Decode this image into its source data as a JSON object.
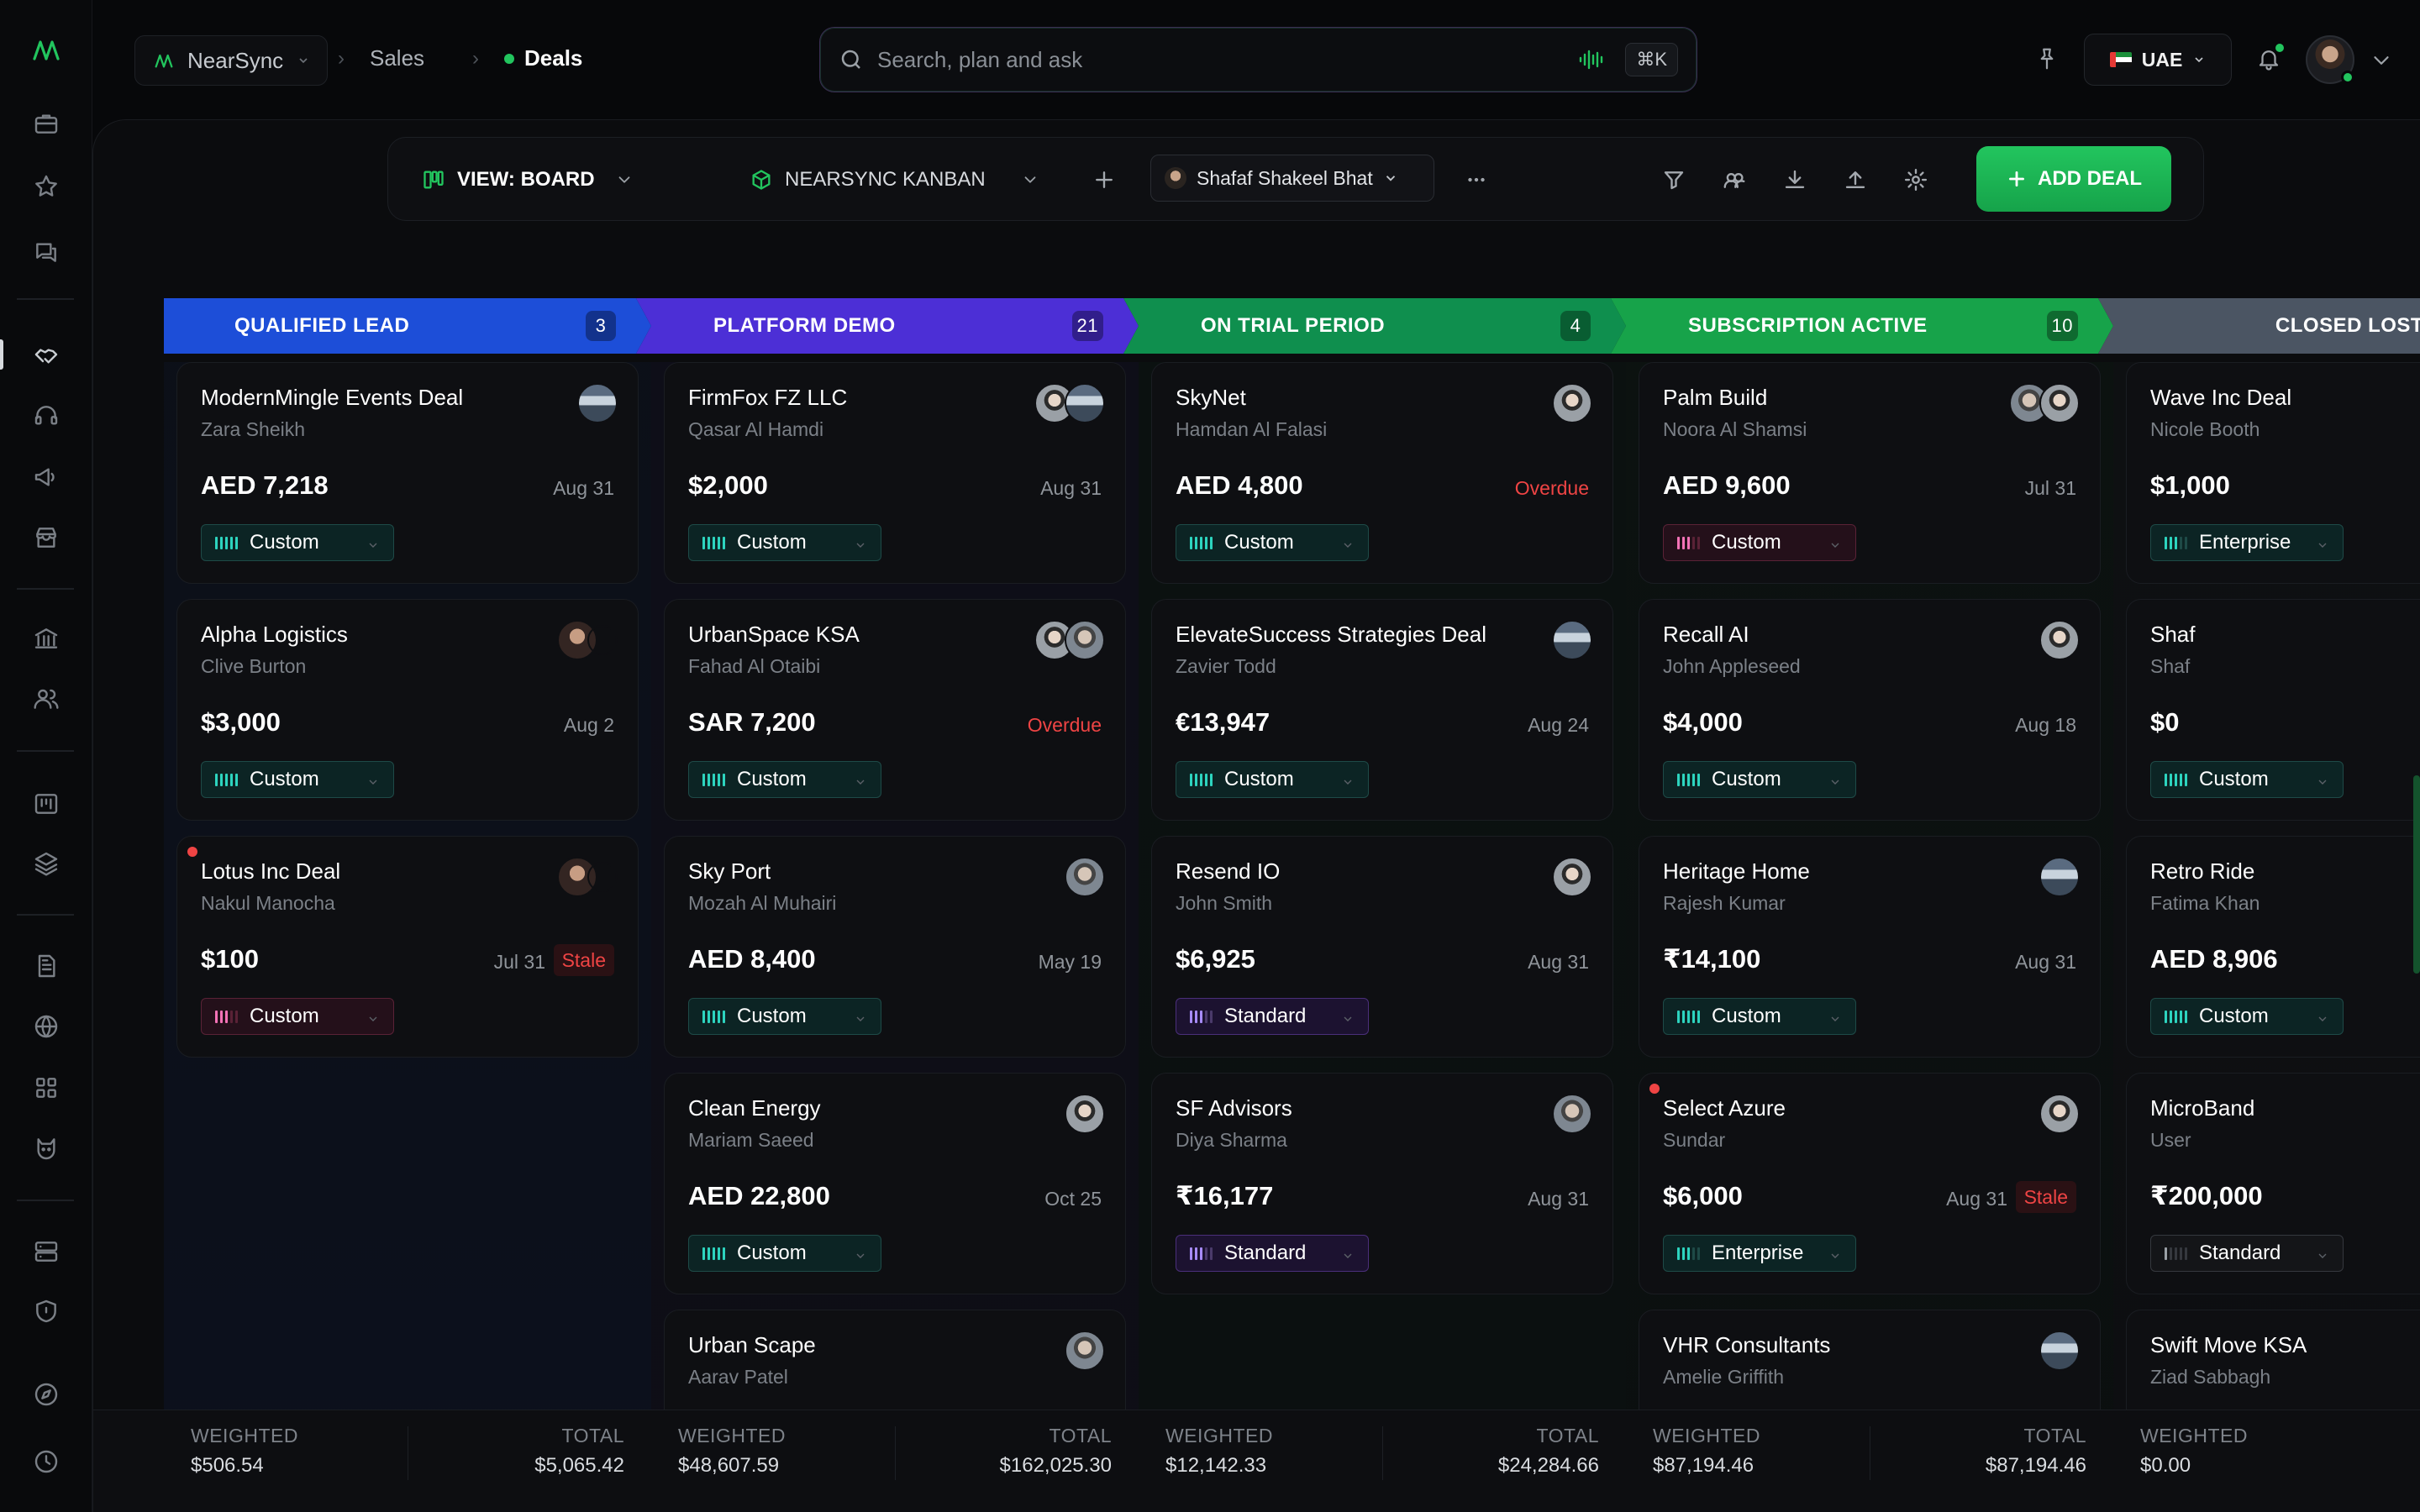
{
  "brand": {
    "name": "NearSync"
  },
  "breadcrumb": {
    "workspace": "NearSync",
    "section": "Sales",
    "current": "Deals"
  },
  "search": {
    "placeholder": "Search, plan and ask",
    "shortcut": "⌘K"
  },
  "region": {
    "label": "UAE"
  },
  "toolbar": {
    "view_label": "VIEW: BOARD",
    "pipeline_label": "NEARSYNC KANBAN",
    "owner_name": "Shafaf Shakeel Bhat",
    "add_deal_label": "ADD DEAL"
  },
  "colors": {
    "accent": "#22c55e",
    "qualified_lead": "#1d4ed8",
    "platform_demo": "#4c2fd6",
    "on_trial": "#0f8f4e",
    "subscription_active": "#17a34a",
    "closed_lost": "#4b5563",
    "overdue": "#ef4444"
  },
  "stages": [
    {
      "name": "QUALIFIED LEAD",
      "count": "3"
    },
    {
      "name": "PLATFORM DEMO",
      "count": "21"
    },
    {
      "name": "ON TRIAL PERIOD",
      "count": "4"
    },
    {
      "name": "SUBSCRIPTION ACTIVE",
      "count": "10"
    },
    {
      "name": "CLOSED LOST",
      "count": ""
    }
  ],
  "columns": [
    {
      "cards": [
        {
          "title": "ModernMingle Events Deal",
          "contact": "Zara Sheikh",
          "amount": "AED 7,218",
          "date": "Aug 31",
          "plan": "Custom"
        },
        {
          "title": "Alpha Logistics",
          "contact": "Clive Burton",
          "amount": "$3,000",
          "date": "Aug 2",
          "plan": "Custom"
        },
        {
          "title": "Lotus Inc Deal",
          "contact": "Nakul Manocha",
          "amount": "$100",
          "date": "Jul 31",
          "stale": "Stale",
          "plan": "Custom"
        }
      ]
    },
    {
      "cards": [
        {
          "title": "FirmFox FZ LLC",
          "contact": "Qasar Al Hamdi",
          "amount": "$2,000",
          "date": "Aug 31",
          "plan": "Custom"
        },
        {
          "title": "UrbanSpace KSA",
          "contact": "Fahad Al Otaibi",
          "amount": "SAR 7,200",
          "date": "Overdue",
          "plan": "Custom"
        },
        {
          "title": "Sky Port",
          "contact": "Mozah Al Muhairi",
          "amount": "AED 8,400",
          "date": "May 19",
          "plan": "Custom"
        },
        {
          "title": "Clean Energy",
          "contact": "Mariam Saeed",
          "amount": "AED 22,800",
          "date": "Oct 25",
          "plan": "Custom"
        },
        {
          "title": "Urban Scape",
          "contact": "Aarav Patel"
        }
      ]
    },
    {
      "cards": [
        {
          "title": "SkyNet",
          "contact": "Hamdan Al Falasi",
          "amount": "AED 4,800",
          "date": "Overdue",
          "plan": "Custom"
        },
        {
          "title": "ElevateSuccess Strategies Deal",
          "contact": "Zavier Todd",
          "amount": "€13,947",
          "date": "Aug 24",
          "plan": "Custom"
        },
        {
          "title": "Resend IO",
          "contact": "John Smith",
          "amount": "$6,925",
          "date": "Aug 31",
          "plan": "Standard"
        },
        {
          "title": "SF Advisors",
          "contact": "Diya Sharma",
          "amount": "₹16,177",
          "date": "Aug 31",
          "plan": "Standard"
        }
      ]
    },
    {
      "cards": [
        {
          "title": "Palm Build",
          "contact": "Noora Al Shamsi",
          "amount": "AED 9,600",
          "date": "Jul 31",
          "plan": "Custom"
        },
        {
          "title": "Recall AI",
          "contact": "John Appleseed",
          "amount": "$4,000",
          "date": "Aug 18",
          "plan": "Custom"
        },
        {
          "title": "Heritage Home",
          "contact": "Rajesh Kumar",
          "amount": "₹14,100",
          "date": "Aug 31",
          "plan": "Custom"
        },
        {
          "title": "Select Azure",
          "contact": "Sundar",
          "amount": "$6,000",
          "date": "Aug 31",
          "stale": "Stale",
          "plan": "Enterprise"
        },
        {
          "title": "VHR Consultants",
          "contact": "Amelie Griffith"
        }
      ]
    },
    {
      "cards": [
        {
          "title": "Wave Inc Deal",
          "contact": "Nicole Booth",
          "amount": "$1,000",
          "plan": "Enterprise"
        },
        {
          "title": "Shaf",
          "contact": "Shaf",
          "amount": "$0",
          "plan": "Custom"
        },
        {
          "title": "Retro Ride",
          "contact": "Fatima Khan",
          "amount": "AED 8,906",
          "plan": "Custom"
        },
        {
          "title": "MicroBand",
          "contact": "User",
          "amount": "₹200,000",
          "plan": "Standard"
        },
        {
          "title": "Swift Move KSA",
          "contact": "Ziad Sabbagh"
        }
      ]
    }
  ],
  "footer": {
    "weighted_label": "WEIGHTED",
    "total_label": "TOTAL",
    "columns": [
      {
        "weighted": "$506.54",
        "total": "$5,065.42"
      },
      {
        "weighted": "$48,607.59",
        "total": "$162,025.30"
      },
      {
        "weighted": "$12,142.33",
        "total": "$24,284.66"
      },
      {
        "weighted": "$87,194.46",
        "total": "$87,194.46"
      },
      {
        "weighted": "$0.00"
      }
    ]
  }
}
